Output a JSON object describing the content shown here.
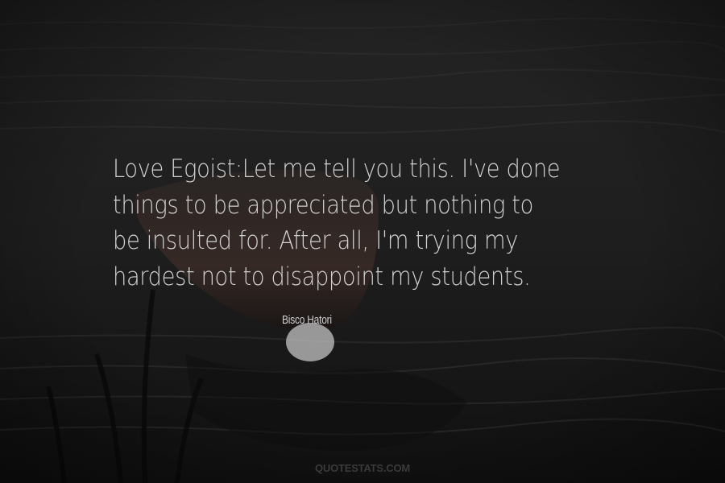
{
  "quote": {
    "text": "Love Egoist:Let me tell you this. I've done things to be appreciated but nothing to be insulted for. After all, I'm trying my hardest not to disappoint my students."
  },
  "author": {
    "name": "Bisco Hatori"
  },
  "watermark": {
    "text": "QUOTESTATS.COM"
  },
  "colors": {
    "text": "#d2d2d2",
    "background": "#1c1c1c"
  }
}
